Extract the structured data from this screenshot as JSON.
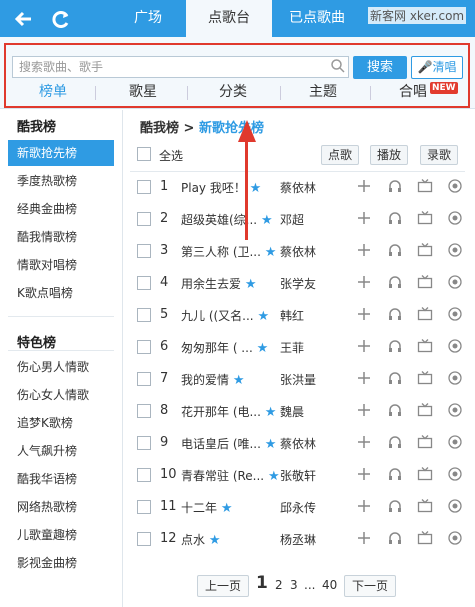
{
  "topbar": {
    "tabs": [
      {
        "label": "广场"
      },
      {
        "label": "点歌台"
      },
      {
        "label": "已点歌曲"
      }
    ],
    "watermark": "新客网 xker.com"
  },
  "search": {
    "placeholder": "搜索歌曲、歌手",
    "button": "搜索",
    "clear": "清唱"
  },
  "categories": [
    "榜单",
    "歌星",
    "分类",
    "主题",
    "合唱"
  ],
  "new_badge": "NEW",
  "sidebar": {
    "group1_title": "酷我榜",
    "group1_items": [
      "新歌抢先榜",
      "季度热歌榜",
      "经典金曲榜",
      "酷我情歌榜",
      "情歌对唱榜",
      "K歌点唱榜"
    ],
    "group2_title": "特色榜",
    "group2_items": [
      "伤心男人情歌",
      "伤心女人情歌",
      "追梦K歌榜",
      "人气飙升榜",
      "酷我华语榜",
      "网络热歌榜",
      "儿歌童趣榜",
      "影视金曲榜"
    ]
  },
  "breadcrumb": {
    "root": "酷我榜",
    "sep": ">",
    "current": "新歌抢先榜"
  },
  "controls": {
    "select_all": "全选",
    "order": "点歌",
    "play": "播放",
    "record": "录歌"
  },
  "songs": [
    {
      "num": "1",
      "title": "Play 我呸！",
      "artist": "蔡依林"
    },
    {
      "num": "2",
      "title": "超级英雄(综...",
      "artist": "邓超"
    },
    {
      "num": "3",
      "title": "第三人称 (卫...",
      "artist": "蔡依林"
    },
    {
      "num": "4",
      "title": "用余生去爱",
      "artist": "张学友"
    },
    {
      "num": "5",
      "title": "九儿 ((又名...",
      "artist": "韩红"
    },
    {
      "num": "6",
      "title": "匆匆那年 ( ...",
      "artist": "王菲"
    },
    {
      "num": "7",
      "title": "我的爱情",
      "artist": "张洪量"
    },
    {
      "num": "8",
      "title": "花开那年 (电...",
      "artist": "魏晨"
    },
    {
      "num": "9",
      "title": "电话皇后 (唯...",
      "artist": "蔡依林"
    },
    {
      "num": "10",
      "title": "青春常驻 (Re...",
      "artist": "张敬轩"
    },
    {
      "num": "11",
      "title": "十二年",
      "artist": "邱永传"
    },
    {
      "num": "12",
      "title": "点水",
      "artist": "杨丞琳"
    }
  ],
  "pager": {
    "prev": "上一页",
    "current": "1",
    "p2": "2",
    "p3": "3",
    "dots": "...",
    "last": "40",
    "next": "下一页"
  },
  "colors": {
    "accent": "#2f9be3",
    "highlight_box": "#e0392d",
    "new_badge": "#e23b2e"
  }
}
